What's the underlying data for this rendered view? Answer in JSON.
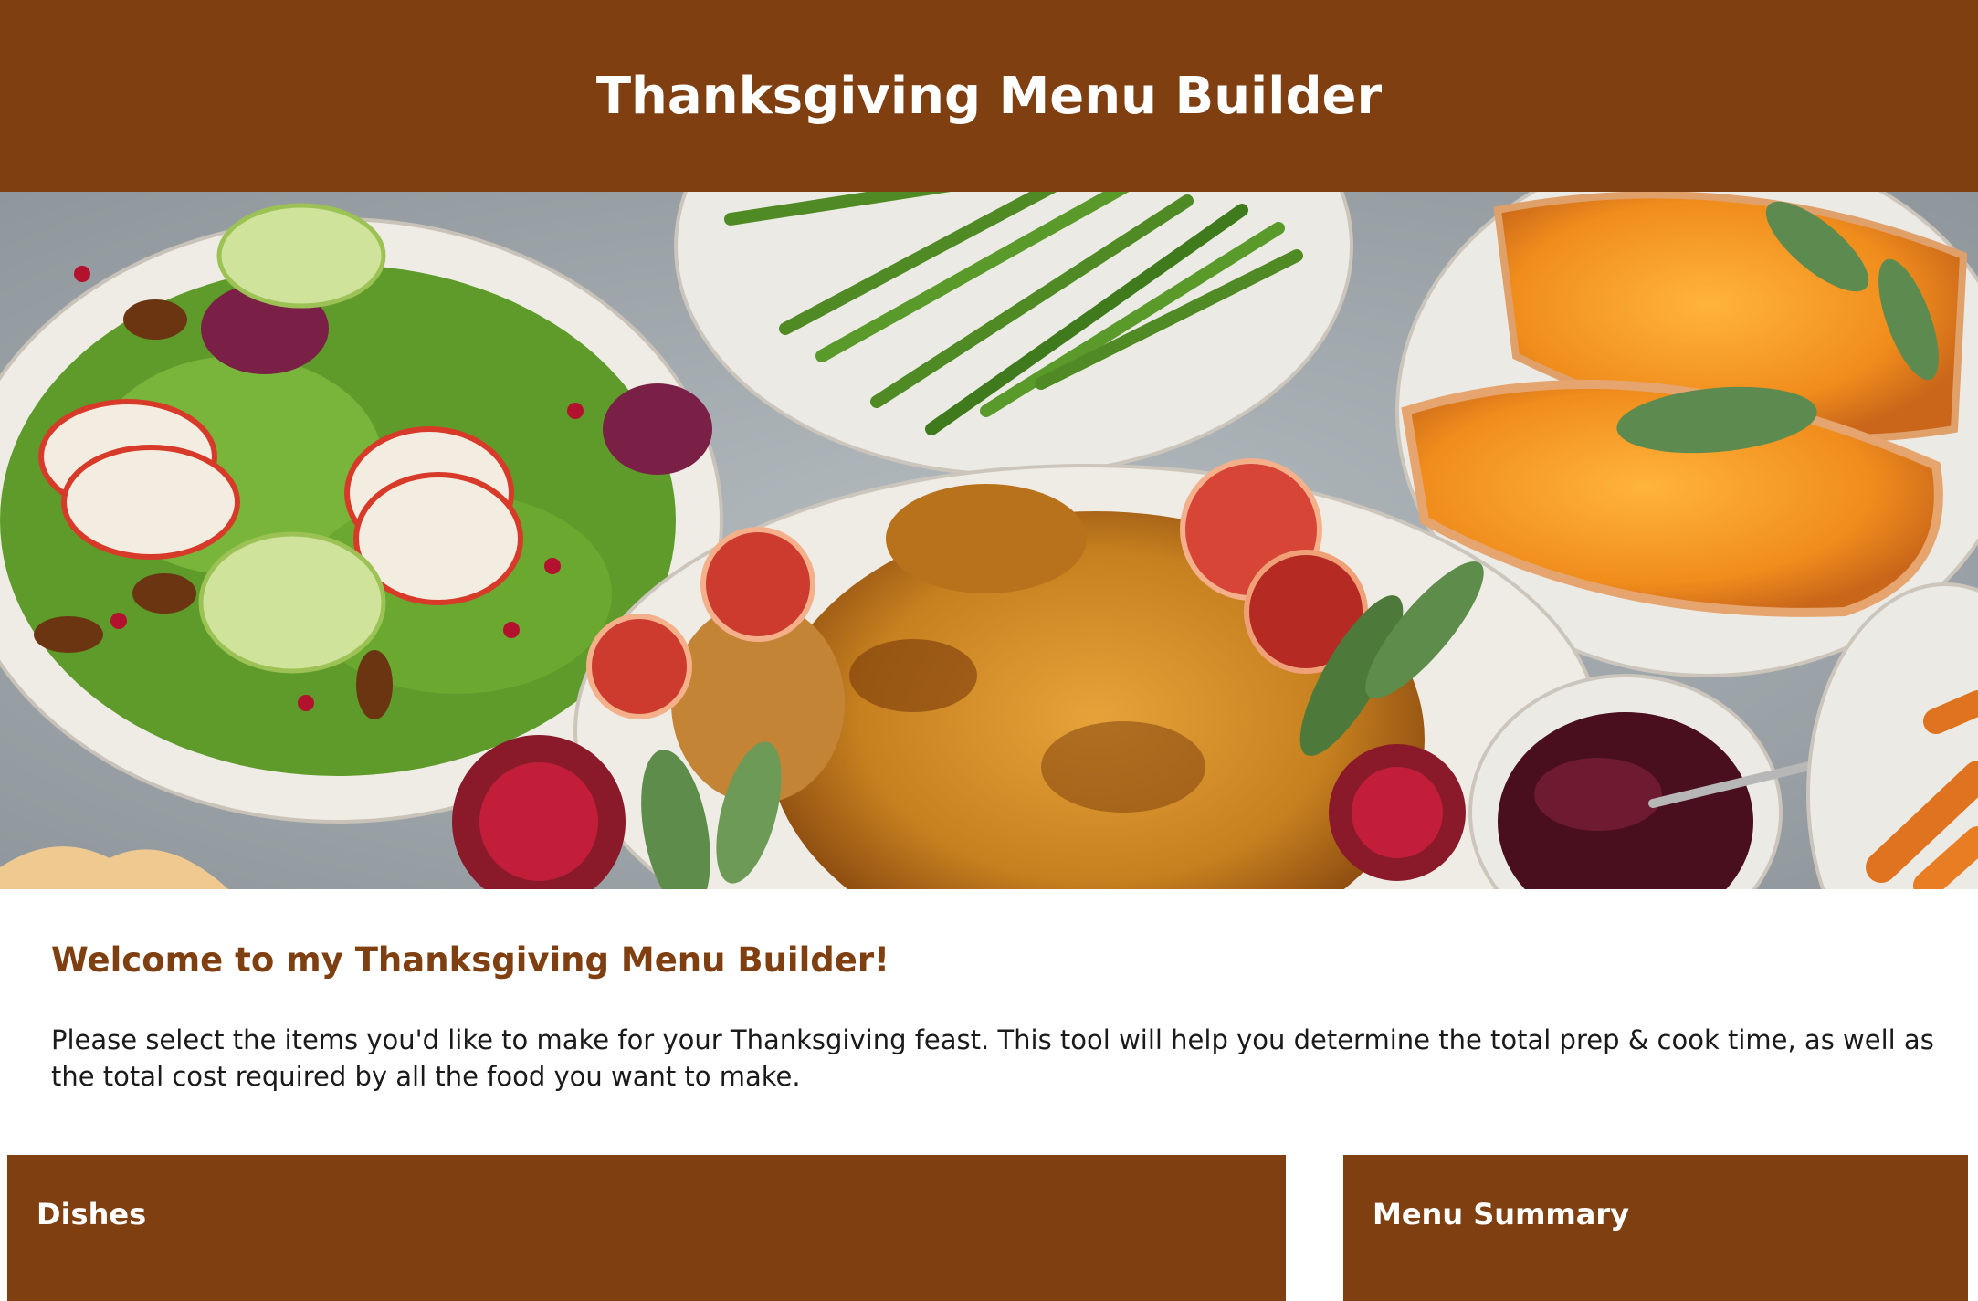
{
  "header": {
    "title": "Thanksgiving Menu Builder"
  },
  "hero": {
    "icon": "thanksgiving-feast-photo",
    "colors": {
      "table": "#9ea6ab",
      "plate": "#eceae4",
      "turkey": "#c6801f",
      "squash": "#f08d1c",
      "beans": "#4f8a24",
      "cranberry": "#4a0f1f"
    }
  },
  "intro": {
    "heading": "Welcome to my Thanksgiving Menu Builder!",
    "paragraph": "Please select the items you'd like to make for your Thanksgiving feast. This tool will help you determine the total prep & cook time, as well as the total cost required by all the food you want to make."
  },
  "panels": {
    "dishes_title": "Dishes",
    "summary_title": "Menu Summary"
  },
  "theme": {
    "brand": "#7f3f11",
    "text": "#1a1a1a",
    "background": "#ffffff"
  }
}
